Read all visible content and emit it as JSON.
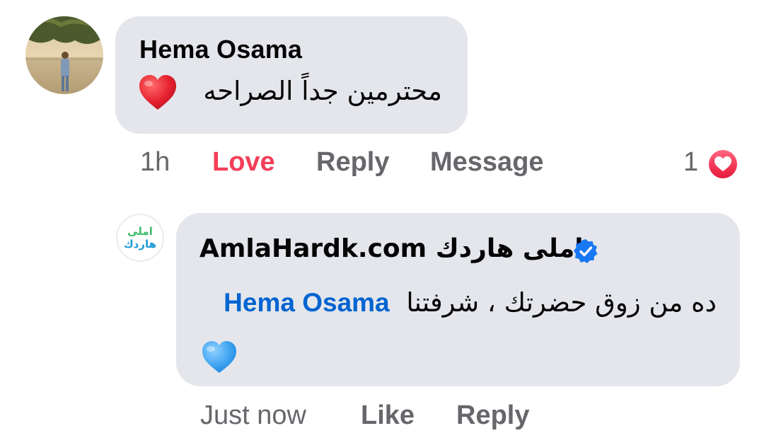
{
  "comment": {
    "author": "Hema Osama",
    "text": "محترمين جداً الصراحه",
    "emoji": "red-heart",
    "time": "1h",
    "actions": {
      "reaction_label": "Love",
      "reply_label": "Reply",
      "message_label": "Message"
    },
    "reaction_count": "1",
    "reaction_icon": "love-reaction-icon",
    "colors": {
      "love": "#f33e58",
      "bubble": "#e4e6eb",
      "secondary_text": "#65676b"
    }
  },
  "reply": {
    "author": "AmlaHardk.com املى هاردك",
    "verified": true,
    "avatar_text_line1": "املى",
    "avatar_text_line2": "هاردك",
    "mention": "Hema Osama",
    "text": "ده من زوق حضرتك ، شرفتنا",
    "emoji": "blue-heart",
    "time": "Just now",
    "actions": {
      "like_label": "Like",
      "reply_label": "Reply"
    },
    "colors": {
      "mention": "#0064d1",
      "verified": "#1877f2",
      "avatar_green": "#3dbb6a",
      "avatar_blue": "#1e9ad6"
    }
  }
}
